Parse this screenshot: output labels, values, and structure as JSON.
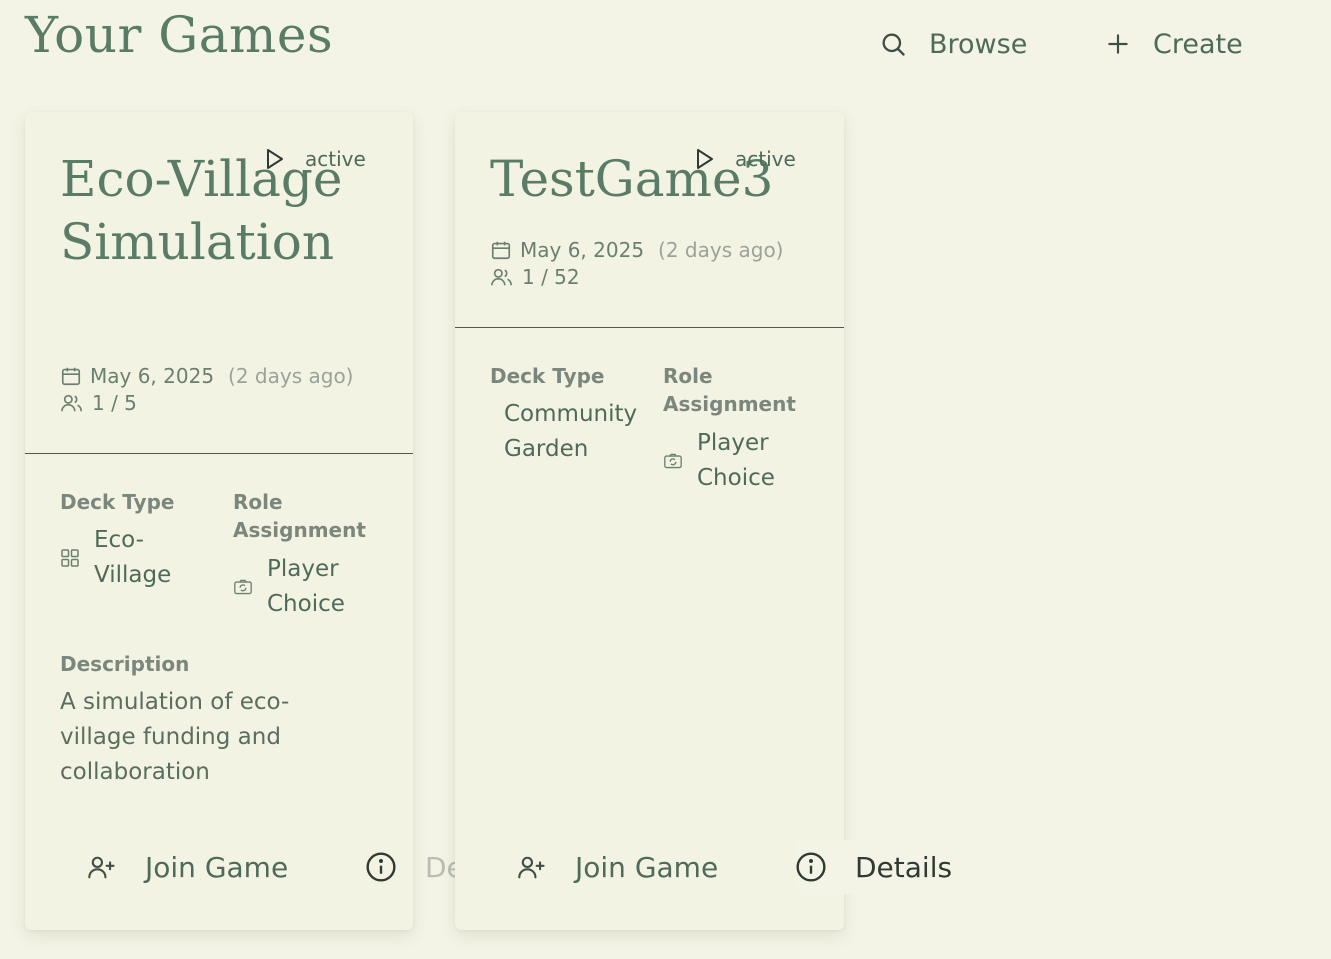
{
  "header": {
    "title": "Your Games",
    "browse_label": "Browse",
    "create_label": "Create"
  },
  "games": [
    {
      "status": "active",
      "title": "Eco-Village Simulation",
      "date": "May 6, 2025",
      "relative": "(2 days ago)",
      "players": "1 / 5",
      "deck_type_label": "Deck Type",
      "deck_type": "Eco-Village",
      "role_label": "Role Assignment",
      "role": "Player Choice",
      "description_label": "Description",
      "description": "A simulation of eco-village funding and collaboration",
      "join_label": "Join Game",
      "details_label": "Details"
    },
    {
      "status": "active",
      "title": "TestGame3",
      "date": "May 6, 2025",
      "relative": "(2 days ago)",
      "players": "1 / 52",
      "deck_type_label": "Deck Type",
      "deck_type": "Community Garden",
      "role_label": "Role Assignment",
      "role": "Player Choice",
      "join_label": "Join Game",
      "details_label": "Details"
    }
  ],
  "colors": {
    "background": "#f4f4e6",
    "card": "#f3f3e3",
    "title_green": "#5a7c66",
    "text": "#4f6a5a",
    "label_gray": "#7b877d"
  }
}
